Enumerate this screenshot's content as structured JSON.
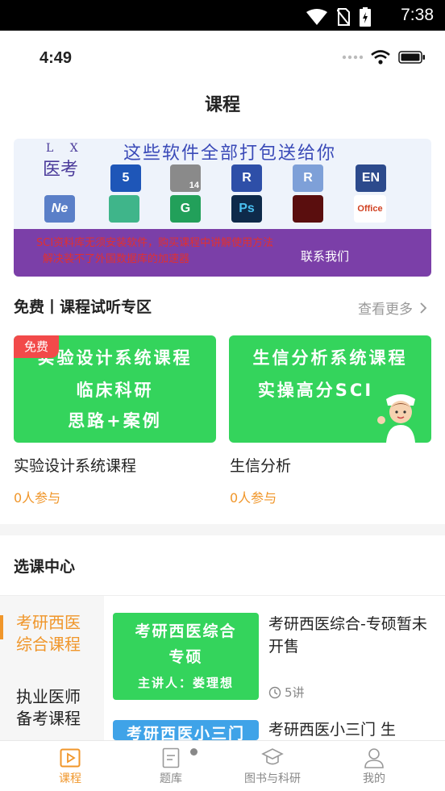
{
  "android_status": {
    "time": "7:38"
  },
  "ios_status": {
    "time": "4:49"
  },
  "page_title": "课程",
  "banner": {
    "logo_top": "L X",
    "logo_main": "医考",
    "headline": "这些软件全部打包送给你",
    "app_icons": [
      "5",
      "14",
      "R",
      "R",
      "EN",
      "Ne",
      "",
      "G",
      "Ps",
      "",
      "Office"
    ],
    "notice_line1": "SCI资料库无须安装软件，购买课程中讲解使用方法",
    "notice_line2": "解决装不了外国数据库的加速器",
    "contact": "联系我们"
  },
  "free_section": {
    "title": "免费丨课程试听专区",
    "more": "查看更多",
    "free_tag": "免费",
    "cards": [
      {
        "image_lines": [
          "实验设计系统课程",
          "临床科研",
          "思路+案例"
        ],
        "title": "实验设计系统课程",
        "count": "0人参与"
      },
      {
        "image_lines": [
          "生信分析系统课程",
          "实操高分SCI"
        ],
        "title": "生信分析",
        "count": "0人参与"
      }
    ]
  },
  "course_center": {
    "title": "选课中心",
    "categories": [
      {
        "line1": "考研西医",
        "line2": "综合课程"
      },
      {
        "line1": "执业医师",
        "line2": "备考课程"
      }
    ],
    "courses": [
      {
        "image_lines": [
          "考研西医综合",
          "专硕",
          "主讲人：娄理想"
        ],
        "title": "考研西医综合-专硕暂未开售",
        "lessons": "5讲"
      },
      {
        "image_lines": [
          "考研西医小三门"
        ],
        "title": "考研西医小三门 生"
      }
    ]
  },
  "tabbar": {
    "items": [
      {
        "label": "课程",
        "icon": "play-square-icon"
      },
      {
        "label": "题库",
        "icon": "document-icon"
      },
      {
        "label": "图书与科研",
        "icon": "graduation-cap-icon"
      },
      {
        "label": "我的",
        "icon": "person-icon"
      }
    ]
  },
  "colors": {
    "accent": "#f0962a",
    "card_green": "#34d45c",
    "free_red": "#f24a4a",
    "banner_purple": "#7b3fa8"
  }
}
